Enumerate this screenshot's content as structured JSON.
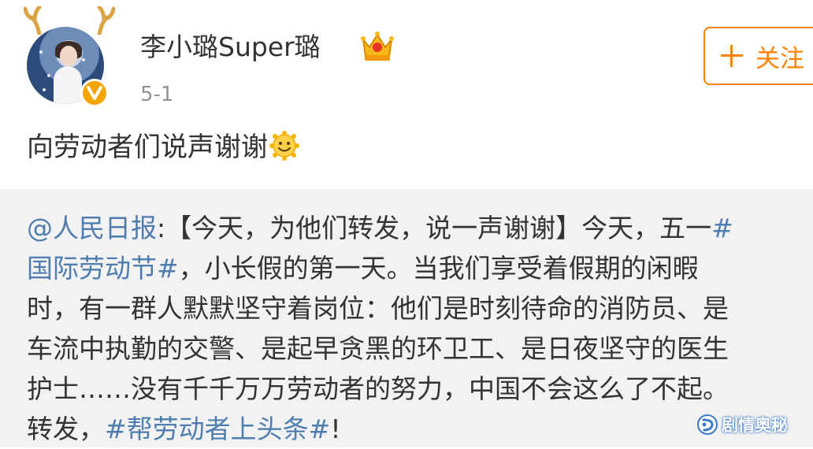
{
  "post": {
    "author": "李小璐Super璐",
    "time": "5-1",
    "follow_label": "关注",
    "text": "向劳动者们说声谢谢"
  },
  "repost": {
    "mention": "@人民日报",
    "line1_rest": ":【今天，为他们转发，说一声谢谢】今天，五一",
    "topic1_start": "#",
    "topic1_end": "国际劳动节#",
    "line2_rest": "，小长假的第一天。当我们享受着假期的闲暇",
    "line3": "时，有一群人默默坚守着岗位：他们是时刻待命的消防员、是",
    "line4": "车流中执勤的交警、是起早贪黑的环卫工、是日夜坚守的医生",
    "line5": "护士……没有千千万万劳动者的努力，中国不会这么了不起。",
    "line6_start": "转发，",
    "topic2": "#帮劳动者上头条#",
    "line6_end": "!"
  },
  "watermark": "剧情奥秘",
  "colors": {
    "accent_orange": "#ff8200",
    "link_blue": "#507daf",
    "verified_gold": "#f7a400",
    "repost_bg": "#f2f2f2"
  },
  "icons": [
    "antler-icon",
    "verified-badge-icon",
    "crown-icon",
    "plus-icon",
    "smile-emoji-icon",
    "watermark-logo-icon"
  ]
}
